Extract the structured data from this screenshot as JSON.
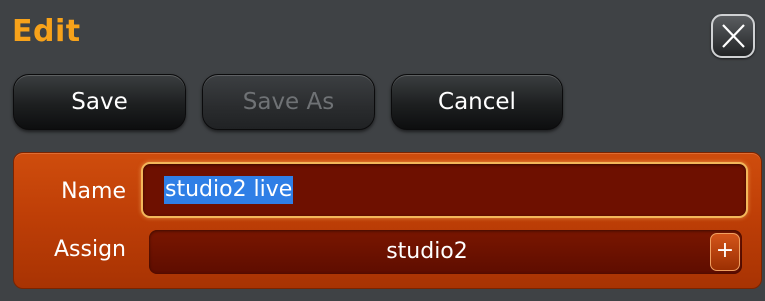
{
  "dialog": {
    "title": "Edit"
  },
  "toolbar": {
    "save_label": "Save",
    "save_as_label": "Save As",
    "cancel_label": "Cancel"
  },
  "form": {
    "name_label": "Name",
    "name_value": "studio2 live",
    "assign_label": "Assign",
    "assign_value": "studio2",
    "assign_add_label": "+"
  },
  "icons": {
    "close": "close-icon"
  },
  "colors": {
    "title": "#f7a21a",
    "panel": "#c0430a",
    "selection": "#2f7fe6",
    "input_border": "#f3b75a"
  }
}
